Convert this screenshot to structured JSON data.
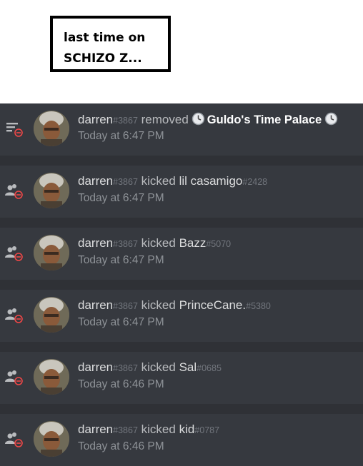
{
  "caption": {
    "line1": "last time on",
    "line2": "SCHIZO Z..."
  },
  "entries": [
    {
      "icon": "channel-delete-icon",
      "user": "darren",
      "user_disc": "#3867",
      "action": "removed",
      "target": "Guldo's Time Palace",
      "target_disc": "",
      "target_emoji": "clock-emoji",
      "time": "Today at 6:47 PM"
    },
    {
      "icon": "member-kick-icon",
      "user": "darren",
      "user_disc": "#3867",
      "action": "kicked",
      "target": "lil casamigo",
      "target_disc": "#2428",
      "time": "Today at 6:47 PM"
    },
    {
      "icon": "member-kick-icon",
      "user": "darren",
      "user_disc": "#3867",
      "action": "kicked",
      "target": "Bazz",
      "target_disc": "#5070",
      "time": "Today at 6:47 PM"
    },
    {
      "icon": "member-kick-icon",
      "user": "darren",
      "user_disc": "#3867",
      "action": "kicked",
      "target": "PrinceCane.",
      "target_disc": "#5380",
      "time": "Today at 6:47 PM"
    },
    {
      "icon": "member-kick-icon",
      "user": "darren",
      "user_disc": "#3867",
      "action": "kicked",
      "target": "Sal",
      "target_disc": "#0685",
      "time": "Today at 6:46 PM"
    },
    {
      "icon": "member-kick-icon",
      "user": "darren",
      "user_disc": "#3867",
      "action": "kicked",
      "target": "kid",
      "target_disc": "#0787",
      "time": "Today at 6:46 PM"
    }
  ],
  "colors": {
    "log_background": "#2f3136",
    "entry_background": "#36393f",
    "delete_red": "#f04747",
    "icon_gray": "#b9bbbe"
  }
}
